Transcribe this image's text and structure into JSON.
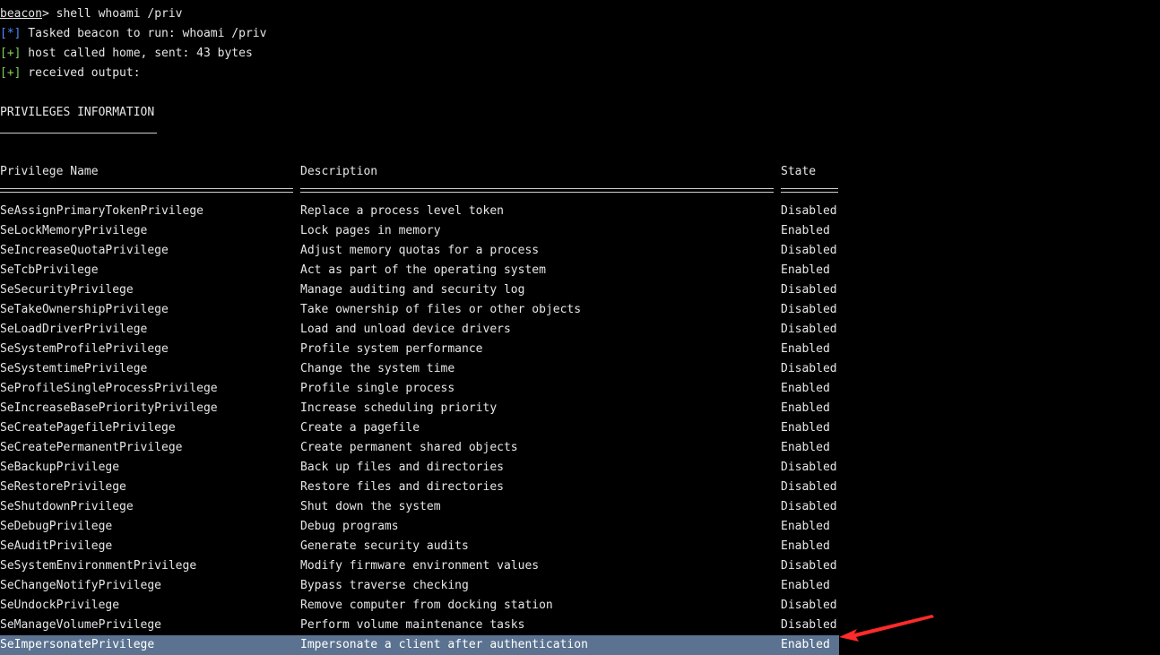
{
  "console": {
    "prompt_host": "beacon",
    "prompt_symbol": ">",
    "command": " shell whoami /priv",
    "lines": [
      {
        "tag": "[*]",
        "text": " Tasked beacon to run: whoami /priv"
      },
      {
        "tag": "[+]",
        "text": " host called home, sent: 43 bytes"
      },
      {
        "tag": "[+]",
        "text": " received output:"
      }
    ]
  },
  "privileges": {
    "title": "PRIVILEGES INFORMATION",
    "headers": {
      "name": "Privilege Name",
      "description": "Description",
      "state": "State"
    },
    "rows": [
      {
        "name": "SeAssignPrimaryTokenPrivilege",
        "description": "Replace a process level token",
        "state": "Disabled"
      },
      {
        "name": "SeLockMemoryPrivilege",
        "description": "Lock pages in memory",
        "state": "Enabled"
      },
      {
        "name": "SeIncreaseQuotaPrivilege",
        "description": "Adjust memory quotas for a process",
        "state": "Disabled"
      },
      {
        "name": "SeTcbPrivilege",
        "description": "Act as part of the operating system",
        "state": "Enabled"
      },
      {
        "name": "SeSecurityPrivilege",
        "description": "Manage auditing and security log",
        "state": "Disabled"
      },
      {
        "name": "SeTakeOwnershipPrivilege",
        "description": "Take ownership of files or other objects",
        "state": "Disabled"
      },
      {
        "name": "SeLoadDriverPrivilege",
        "description": "Load and unload device drivers",
        "state": "Disabled"
      },
      {
        "name": "SeSystemProfilePrivilege",
        "description": "Profile system performance",
        "state": "Enabled"
      },
      {
        "name": "SeSystemtimePrivilege",
        "description": "Change the system time",
        "state": "Disabled"
      },
      {
        "name": "SeProfileSingleProcessPrivilege",
        "description": "Profile single process",
        "state": "Enabled"
      },
      {
        "name": "SeIncreaseBasePriorityPrivilege",
        "description": "Increase scheduling priority",
        "state": "Enabled"
      },
      {
        "name": "SeCreatePagefilePrivilege",
        "description": "Create a pagefile",
        "state": "Enabled"
      },
      {
        "name": "SeCreatePermanentPrivilege",
        "description": "Create permanent shared objects",
        "state": "Enabled"
      },
      {
        "name": "SeBackupPrivilege",
        "description": "Back up files and directories",
        "state": "Disabled"
      },
      {
        "name": "SeRestorePrivilege",
        "description": "Restore files and directories",
        "state": "Disabled"
      },
      {
        "name": "SeShutdownPrivilege",
        "description": "Shut down the system",
        "state": "Disabled"
      },
      {
        "name": "SeDebugPrivilege",
        "description": "Debug programs",
        "state": "Enabled"
      },
      {
        "name": "SeAuditPrivilege",
        "description": "Generate security audits",
        "state": "Enabled"
      },
      {
        "name": "SeSystemEnvironmentPrivilege",
        "description": "Modify firmware environment values",
        "state": "Disabled"
      },
      {
        "name": "SeChangeNotifyPrivilege",
        "description": "Bypass traverse checking",
        "state": "Enabled"
      },
      {
        "name": "SeUndockPrivilege",
        "description": "Remove computer from docking station",
        "state": "Disabled"
      },
      {
        "name": "SeManageVolumePrivilege",
        "description": "Perform volume maintenance tasks",
        "state": "Disabled"
      },
      {
        "name": "SeImpersonatePrivilege",
        "description": "Impersonate a client after authentication",
        "state": "Enabled",
        "highlighted": true
      }
    ]
  },
  "annotation": {
    "arrow_color": "#ff2a2a",
    "highlight_color": "#5b7290",
    "tag_colors": {
      "info": "#4a8cff",
      "ok": "#7fd35a"
    },
    "icon": "arrow-left-icon"
  }
}
